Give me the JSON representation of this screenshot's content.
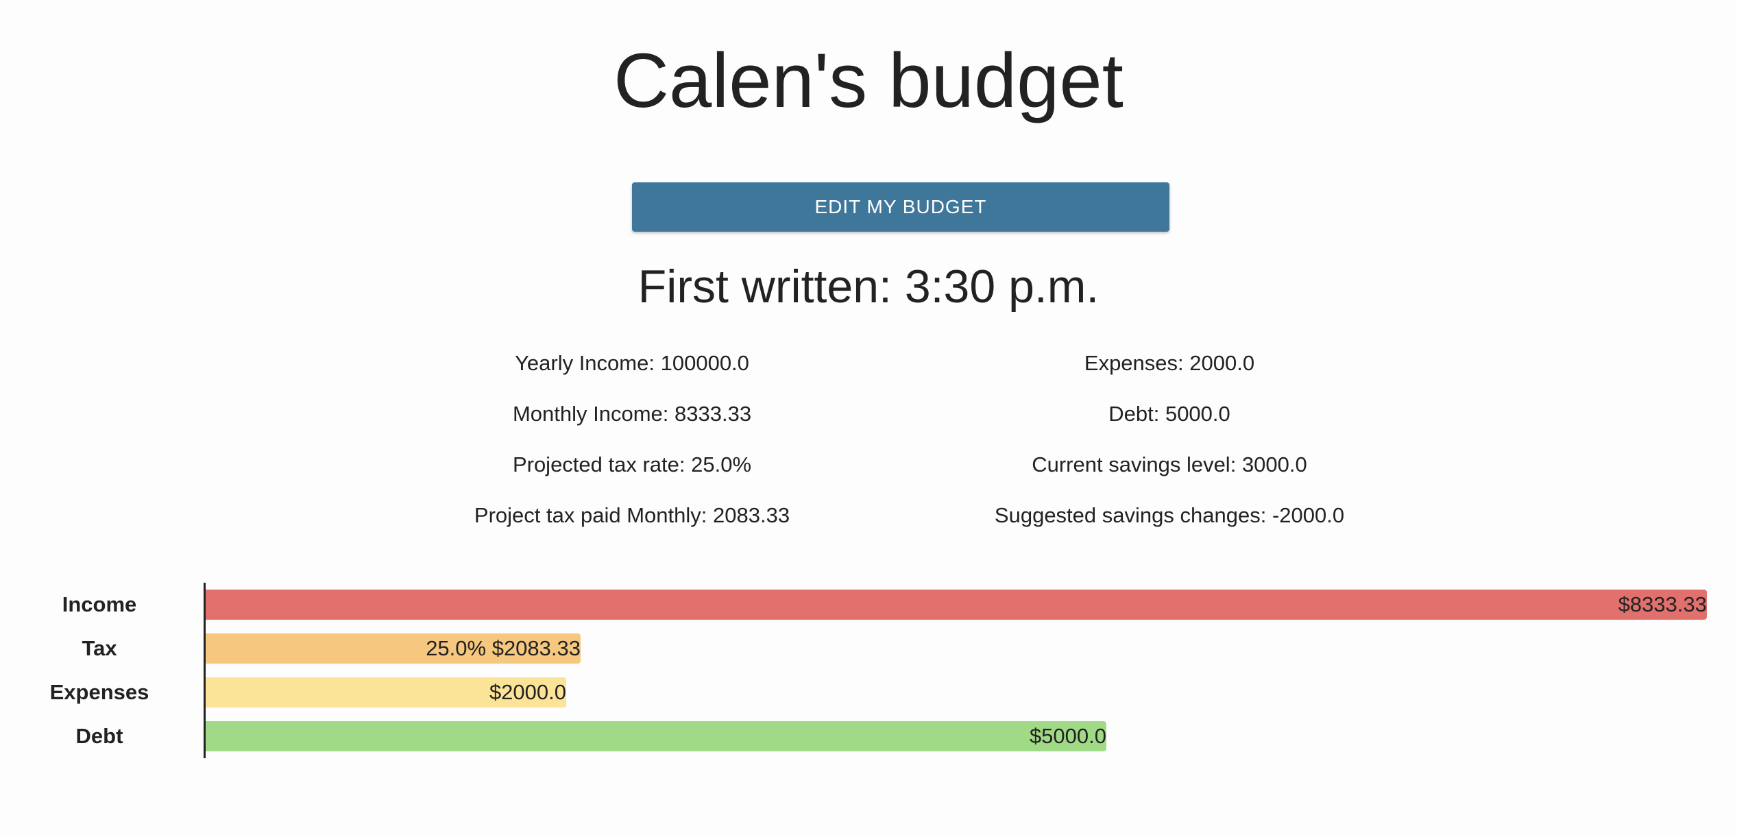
{
  "page": {
    "title": "Calen's budget",
    "edit_button_label": "EDIT MY BUDGET",
    "first_written_label": "First written:",
    "first_written_time": "3:30 p.m."
  },
  "stats_left": [
    {
      "label": "Yearly Income:",
      "value": "100000.0"
    },
    {
      "label": "Monthly Income:",
      "value": "8333.33"
    },
    {
      "label": "Projected tax rate:",
      "value": "25.0%"
    },
    {
      "label": "Project tax paid Monthly:",
      "value": "2083.33"
    }
  ],
  "stats_right": [
    {
      "label": "Expenses:",
      "value": "2000.0"
    },
    {
      "label": "Debt:",
      "value": "5000.0"
    },
    {
      "label": "Current savings level:",
      "value": "3000.0"
    },
    {
      "label": "Suggested savings changes:",
      "value": "-2000.0"
    }
  ],
  "colors": {
    "button": "#3f779b",
    "income": "#e2706d",
    "tax": "#f6c77f",
    "expenses": "#fbe498",
    "debt": "#a1da87"
  },
  "chart_data": {
    "type": "bar",
    "orientation": "horizontal",
    "categories": [
      "Income",
      "Tax",
      "Expenses",
      "Debt"
    ],
    "values": [
      8333.33,
      2083.33,
      2000.0,
      5000.0
    ],
    "value_labels": [
      "$8333.33",
      "25.0% $2083.33",
      "$2000.0",
      "$5000.0"
    ],
    "colors": [
      "#e2706d",
      "#f6c77f",
      "#fbe498",
      "#a1da87"
    ],
    "xlim": [
      0,
      8333.33
    ],
    "grid": false,
    "legend": "none"
  }
}
